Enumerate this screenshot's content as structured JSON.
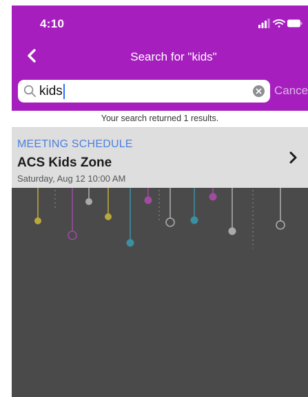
{
  "status_bar": {
    "time": "4:10"
  },
  "nav": {
    "title": "Search for \"kids\""
  },
  "search": {
    "value": "kids",
    "cancel_label": "Cancel"
  },
  "results": {
    "summary": "Your search returned 1 results."
  },
  "result_items": [
    {
      "category": "MEETING SCHEDULE",
      "title": "ACS Kids Zone",
      "subtitle": "Saturday, Aug 12 10:00 AM"
    }
  ],
  "colors": {
    "brand": "#a61fbe",
    "background": "#4a4a4a",
    "category_text": "#4d7fe0"
  },
  "icons": [
    "signal-icon",
    "wifi-icon",
    "battery-icon",
    "back-chevron-icon",
    "search-icon",
    "clear-icon",
    "chevron-right-icon"
  ]
}
